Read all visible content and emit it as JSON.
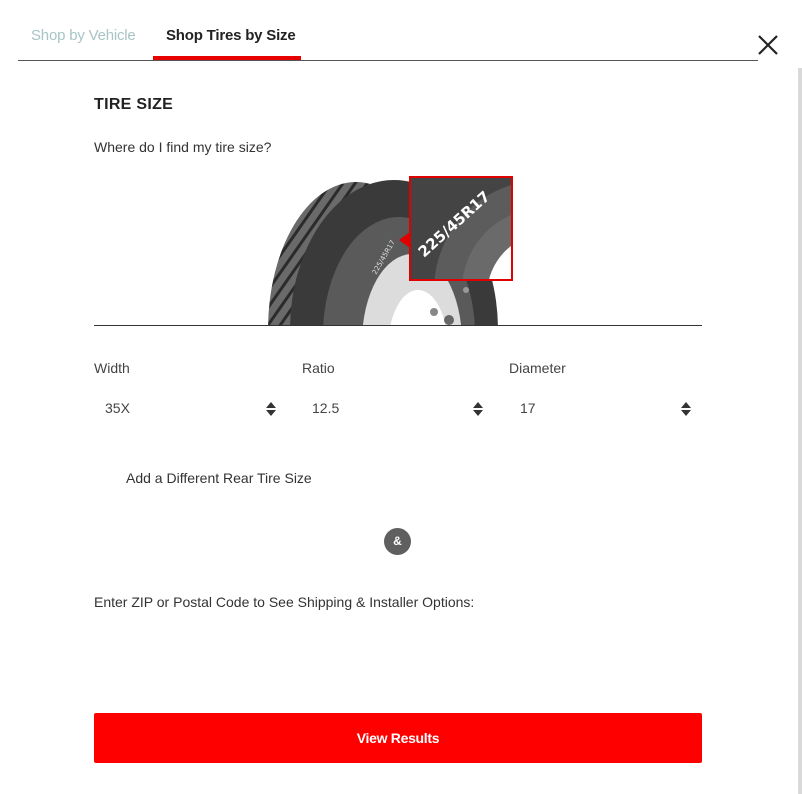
{
  "tabs": {
    "vehicle_label": "Shop by Vehicle",
    "size_label": "Shop Tires by Size",
    "active_color": "#e60000"
  },
  "header": {
    "close_icon": "close-icon"
  },
  "tire_size": {
    "title": "TIRE SIZE",
    "help_link": "Where do I find my tire size?",
    "illustration_size_text": "225/45R17"
  },
  "fields": {
    "width": {
      "label": "Width",
      "value": "35X"
    },
    "ratio": {
      "label": "Ratio",
      "value": "12.5"
    },
    "diameter": {
      "label": "Diameter",
      "value": "17"
    }
  },
  "rear": {
    "link": "Add a Different Rear Tire Size",
    "badge": "&"
  },
  "zip": {
    "label": "Enter ZIP or Postal Code to See Shipping & Installer Options:"
  },
  "actions": {
    "view_results": "View Results",
    "button_color": "#ff0000"
  }
}
